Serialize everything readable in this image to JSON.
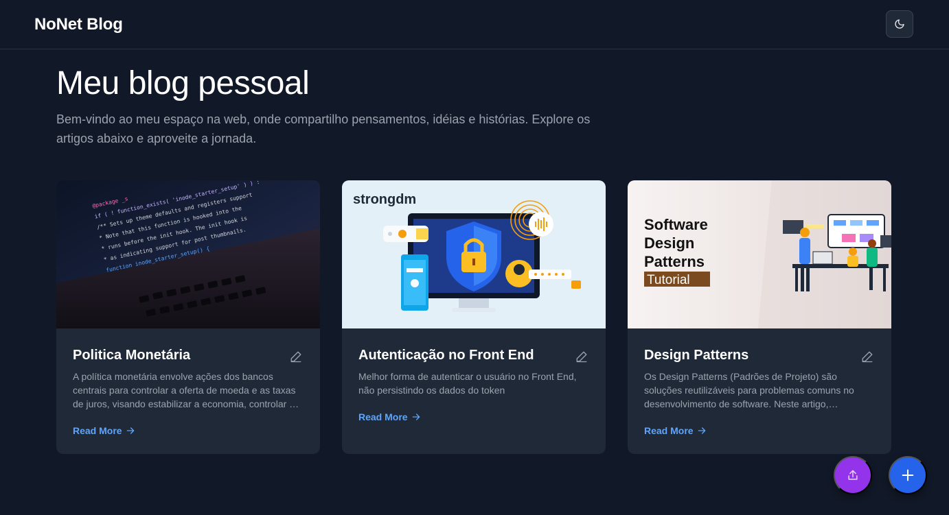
{
  "header": {
    "brand": "NoNet Blog",
    "theme_toggle_icon": "moon-icon"
  },
  "hero": {
    "title": "Meu blog pessoal",
    "subtitle": "Bem-vindo ao meu espaço na web, onde compartilho pensamentos, idéias e histórias. Explore os artigos abaixo e aproveite a jornada."
  },
  "posts": [
    {
      "title": "Politica Monetária",
      "excerpt": "A política monetária envolve ações dos bancos centrais para controlar a oferta de moeda e as taxas de juros, visando estabilizar a economia, controlar a inflação e promover o crescimento.",
      "read_more": "Read More",
      "image": {
        "code_lines": [
          "@package _s",
          "if ( ! function_exists( 'inode_starter_setup' ) ) :",
          "/** Sets up theme defaults and registers support",
          " * Note that this function is hooked into the",
          " * runs before the init hook. The init hook is",
          " * as indicating support for post thumbnails.",
          "function inode_starter_setup() {"
        ]
      }
    },
    {
      "title": "Autenticação no Front End",
      "excerpt": "Melhor forma de autenticar o usuário no Front End, não persistindo os dados do token",
      "read_more": "Read More",
      "image": {
        "logo": "strongdm"
      }
    },
    {
      "title": "Design Patterns",
      "excerpt": "Os Design Patterns (Padrões de Projeto) são soluções reutilizáveis para problemas comuns no desenvolvimento de software. Neste artigo, exploraremos os principais padrões.",
      "read_more": "Read More",
      "image": {
        "lines": [
          "Software",
          "Design",
          "Patterns"
        ],
        "tag": "Tutorial"
      }
    }
  ],
  "actions": {
    "upload_icon": "upload-icon",
    "add_icon": "plus-icon"
  },
  "colors": {
    "background": "#111827",
    "card": "#1f2937",
    "link": "#60a5fa",
    "upload_fab": "#9333ea",
    "add_fab": "#2563eb"
  }
}
